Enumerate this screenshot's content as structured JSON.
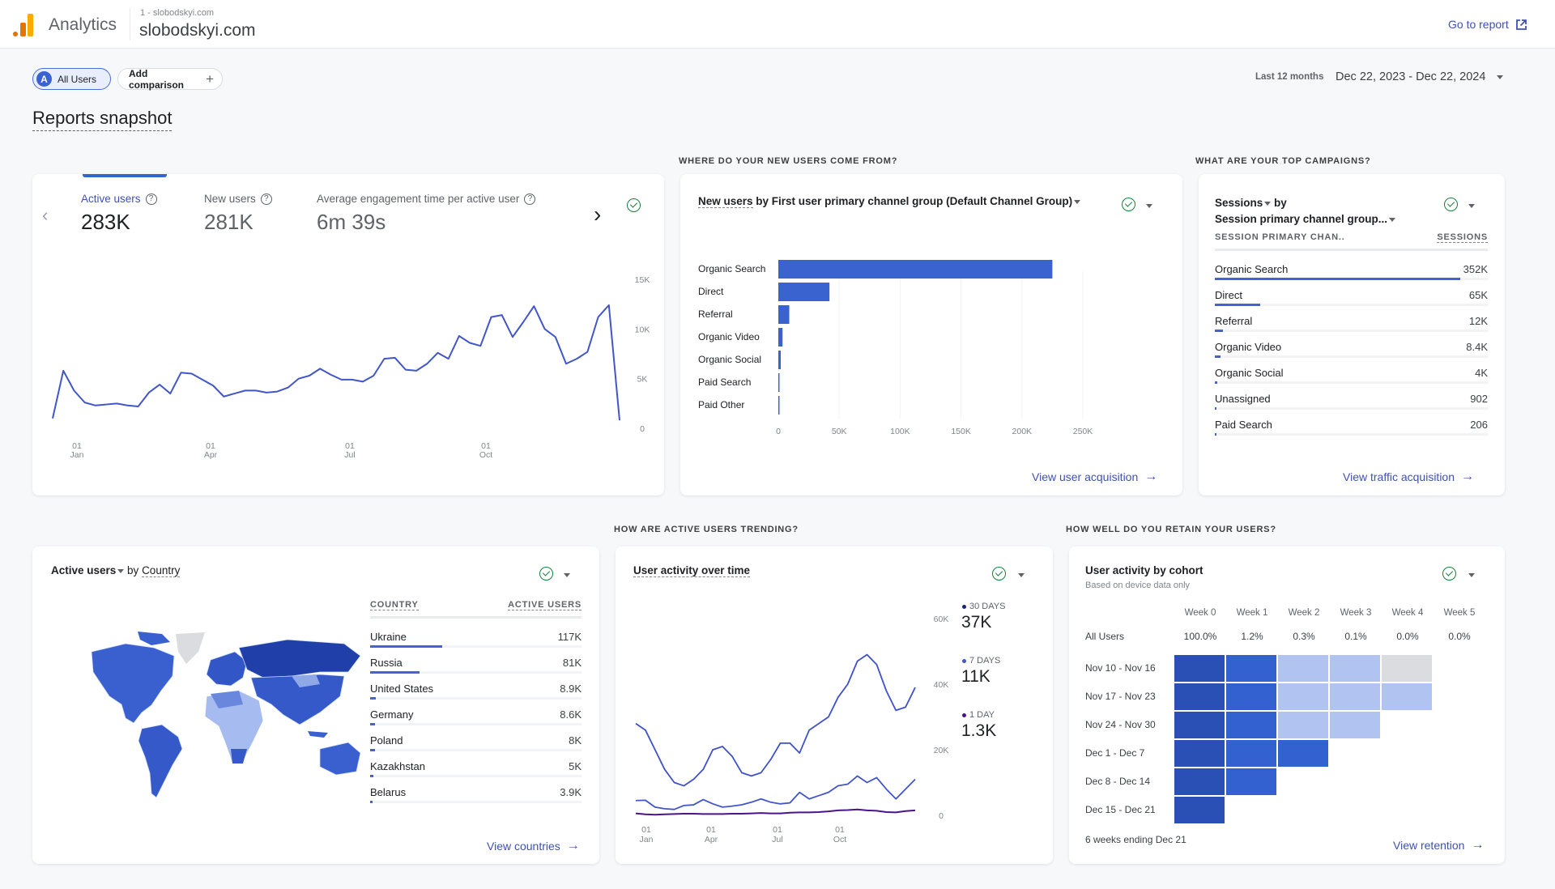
{
  "header": {
    "app_name": "Analytics",
    "property_sub": "1 - slobodskyi.com",
    "property_name": "slobodskyi.com",
    "go_to_report": "Go to report",
    "logo_colors": [
      "#e37400",
      "#f9ab00"
    ]
  },
  "toolbar": {
    "segment_avatar": "A",
    "segment_label": "All Users",
    "add_comparison": "Add comparison",
    "add_icon": "+",
    "date_preset": "Last 12 months",
    "date_range": "Dec 22, 2023 - Dec 22, 2024"
  },
  "page_title": "Reports snapshot",
  "colors": {
    "accent": "#3f51b5",
    "bar": "#3b63d0",
    "line": "#4255c9",
    "check": "#188038"
  },
  "overview": {
    "metrics": [
      {
        "label": "Active users",
        "value": "283K",
        "active": true
      },
      {
        "label": "New users",
        "value": "281K",
        "active": false
      },
      {
        "label": "Average engagement time per active user",
        "value": "6m 39s",
        "active": false
      }
    ],
    "help_glyph": "?",
    "prev_glyph": "‹",
    "next_glyph": "›"
  },
  "sections": {
    "new_users": "WHERE DO YOUR NEW USERS COME FROM?",
    "campaigns": "WHAT ARE YOUR TOP CAMPAIGNS?",
    "trending": "HOW ARE ACTIVE USERS TRENDING?",
    "retain": "HOW WELL DO YOU RETAIN YOUR USERS?"
  },
  "new_users_card": {
    "title_metric": "New users",
    "title_rest": " by First user primary channel group (Default Channel Group)",
    "link": "View user acquisition",
    "arrow": "→"
  },
  "campaigns_card": {
    "title_line1_metric": "Sessions",
    "title_line1_rest": " by",
    "title_line2": "Session primary channel group...",
    "col_dim": "SESSION PRIMARY CHAN..",
    "col_metric": "SESSIONS",
    "rows": [
      {
        "label": "Organic Search",
        "value": "352K",
        "fraction": 1.0
      },
      {
        "label": "Direct",
        "value": "65K",
        "fraction": 0.185
      },
      {
        "label": "Referral",
        "value": "12K",
        "fraction": 0.034
      },
      {
        "label": "Organic Video",
        "value": "8.4K",
        "fraction": 0.024
      },
      {
        "label": "Organic Social",
        "value": "4K",
        "fraction": 0.011
      },
      {
        "label": "Unassigned",
        "value": "902",
        "fraction": 0.0026
      },
      {
        "label": "Paid Search",
        "value": "206",
        "fraction": 0.0006
      }
    ],
    "link": "View traffic acquisition",
    "arrow": "→"
  },
  "country_card": {
    "title_metric": "Active users",
    "title_mid": " by ",
    "title_dim": "Country",
    "col_dim": "COUNTRY",
    "col_metric": "ACTIVE USERS",
    "rows": [
      {
        "label": "Ukraine",
        "value": "117K",
        "fraction": 1.0
      },
      {
        "label": "Russia",
        "value": "81K",
        "fraction": 0.69
      },
      {
        "label": "United States",
        "value": "8.9K",
        "fraction": 0.076
      },
      {
        "label": "Germany",
        "value": "8.6K",
        "fraction": 0.073
      },
      {
        "label": "Poland",
        "value": "8K",
        "fraction": 0.068
      },
      {
        "label": "Kazakhstan",
        "value": "5K",
        "fraction": 0.043
      },
      {
        "label": "Belarus",
        "value": "3.9K",
        "fraction": 0.033
      }
    ],
    "link": "View countries",
    "arrow": "→"
  },
  "activity_card": {
    "title": "User activity over time",
    "legend": [
      {
        "label": "30 DAYS",
        "value": "37K",
        "color": "#1a237e"
      },
      {
        "label": "7 DAYS",
        "value": "11K",
        "color": "#4255c9"
      },
      {
        "label": "1 DAY",
        "value": "1.3K",
        "color": "#4a148c"
      }
    ]
  },
  "cohort_card": {
    "title": "User activity by cohort",
    "subtitle": "Based on device data only",
    "weeks": [
      "Week 0",
      "Week 1",
      "Week 2",
      "Week 3",
      "Week 4",
      "Week 5"
    ],
    "all_users_label": "All Users",
    "all_users": [
      "100.0%",
      "1.2%",
      "0.3%",
      "0.1%",
      "0.0%",
      "0.0%"
    ],
    "cohorts": [
      {
        "label": "Nov 10 - Nov 16",
        "levels": [
          4,
          3,
          1,
          1,
          0
        ]
      },
      {
        "label": "Nov 17 - Nov 23",
        "levels": [
          4,
          3,
          1,
          1,
          1
        ]
      },
      {
        "label": "Nov 24 - Nov 30",
        "levels": [
          4,
          3,
          1,
          1
        ]
      },
      {
        "label": "Dec 1 - Dec 7",
        "levels": [
          4,
          3,
          3
        ]
      },
      {
        "label": "Dec 8 - Dec 14",
        "levels": [
          4,
          3
        ]
      },
      {
        "label": "Dec 15 - Dec 21",
        "levels": [
          4
        ]
      }
    ],
    "footer": "6 weeks ending Dec 21",
    "link": "View retention",
    "arrow": "→"
  },
  "chart_data": [
    {
      "type": "line",
      "title": "Active users",
      "x_ticks": [
        {
          "day": "01",
          "month": "Jan"
        },
        {
          "day": "01",
          "month": "Apr"
        },
        {
          "day": "01",
          "month": "Jul"
        },
        {
          "day": "01",
          "month": "Oct"
        }
      ],
      "y_ticks": [
        "15K",
        "10K",
        "5K",
        "0"
      ],
      "ylim": [
        0,
        15000
      ],
      "series": [
        {
          "name": "Active users (weekly)",
          "values": [
            1000,
            5800,
            3800,
            2600,
            2300,
            2400,
            2500,
            2300,
            2200,
            3600,
            4400,
            3500,
            5600,
            5500,
            4900,
            4300,
            3200,
            3500,
            3800,
            3800,
            3600,
            3700,
            4100,
            5000,
            5300,
            6000,
            5400,
            4900,
            4900,
            4700,
            5300,
            7000,
            7100,
            5900,
            5800,
            6500,
            7600,
            7000,
            9300,
            8600,
            8300,
            11200,
            11400,
            9200,
            10700,
            12300,
            10000,
            9200,
            6500,
            7000,
            7700,
            11200,
            12400,
            800
          ]
        }
      ]
    },
    {
      "type": "bar",
      "title": "New users by First user primary channel group (Default Channel Group)",
      "categories": [
        "Organic Search",
        "Direct",
        "Referral",
        "Organic Video",
        "Organic Social",
        "Paid Search",
        "Paid Other"
      ],
      "values": [
        225000,
        42000,
        9000,
        3500,
        2000,
        500,
        300
      ],
      "x_ticks": [
        "0",
        "50K",
        "100K",
        "150K",
        "200K",
        "250K"
      ],
      "xlim": [
        0,
        250000
      ]
    },
    {
      "type": "line",
      "title": "User activity over time",
      "x_ticks": [
        {
          "day": "01",
          "month": "Jan"
        },
        {
          "day": "01",
          "month": "Apr"
        },
        {
          "day": "01",
          "month": "Jul"
        },
        {
          "day": "01",
          "month": "Oct"
        }
      ],
      "y_ticks": [
        "60K",
        "40K",
        "20K",
        "0"
      ],
      "ylim": [
        0,
        60000
      ],
      "series": [
        {
          "name": "30 DAYS",
          "values": [
            28000,
            26000,
            20000,
            14000,
            10000,
            9000,
            11000,
            14000,
            20000,
            21000,
            18000,
            13000,
            12000,
            13000,
            17000,
            22000,
            22000,
            19000,
            26000,
            28000,
            30000,
            36000,
            40000,
            47000,
            49000,
            46000,
            38000,
            32000,
            33000,
            39000
          ]
        },
        {
          "name": "7 DAYS",
          "values": [
            4500,
            4600,
            2500,
            2000,
            1800,
            3000,
            3200,
            4800,
            3500,
            2500,
            2800,
            3200,
            4000,
            5000,
            4000,
            3500,
            3800,
            7000,
            5000,
            6000,
            7000,
            9000,
            9500,
            12000,
            10000,
            11500,
            8000,
            5000,
            8000,
            11000
          ]
        },
        {
          "name": "1 DAY",
          "values": [
            600,
            300,
            200,
            300,
            400,
            500,
            500,
            400,
            400,
            400,
            500,
            500,
            600,
            700,
            600,
            600,
            800,
            900,
            900,
            1000,
            1200,
            1500,
            1600,
            1800,
            1500,
            1400,
            1000,
            900,
            1300,
            1500
          ]
        }
      ]
    },
    {
      "type": "heatmap",
      "title": "User activity by cohort",
      "columns": [
        "Week 0",
        "Week 1",
        "Week 2",
        "Week 3",
        "Week 4",
        "Week 5"
      ],
      "rows": [
        "Nov 10 - Nov 16",
        "Nov 17 - Nov 23",
        "Nov 24 - Nov 30",
        "Dec 1 - Dec 7",
        "Dec 8 - Dec 14",
        "Dec 15 - Dec 21"
      ],
      "all_users": [
        "100.0%",
        "1.2%",
        "0.3%",
        "0.1%",
        "0.0%",
        "0.0%"
      ]
    }
  ]
}
